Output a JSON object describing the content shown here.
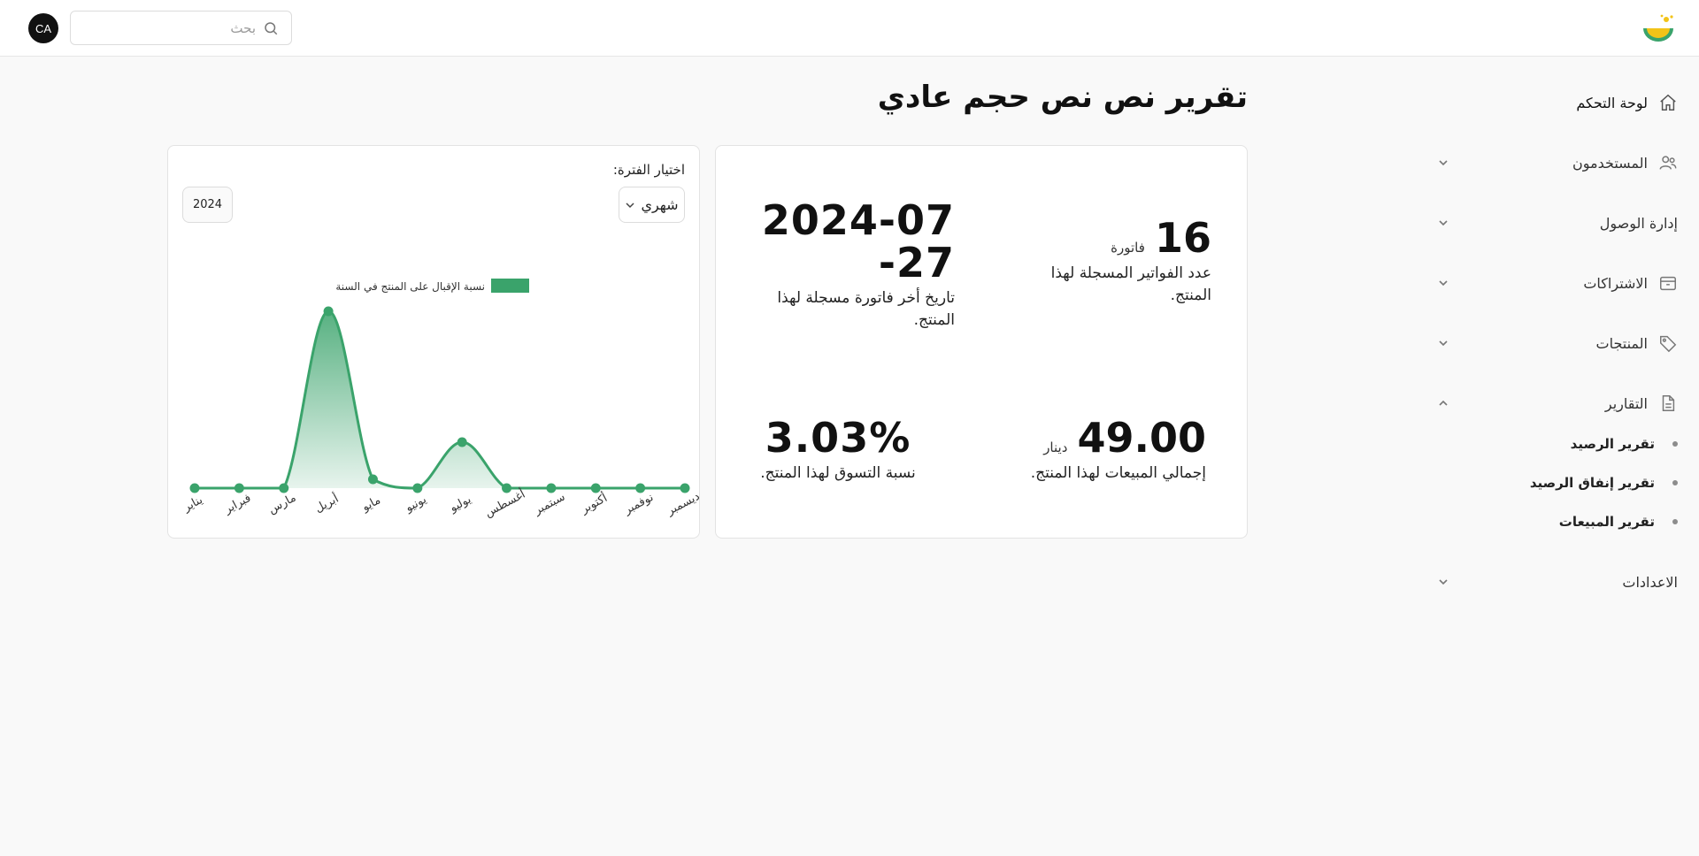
{
  "header": {
    "avatar_initials": "CA",
    "search_placeholder": "بحث",
    "search_icon": "search-icon",
    "logo": "brand-logo"
  },
  "sidebar": {
    "items": [
      {
        "label": "لوحة التحكم",
        "icon": "home-icon",
        "has_chevron": false
      },
      {
        "label": "المستخدمون",
        "icon": "users-icon",
        "has_chevron": true
      },
      {
        "label": "إدارة الوصول",
        "icon": "",
        "has_chevron": true
      },
      {
        "label": "الاشتراكات",
        "icon": "box-icon",
        "has_chevron": true
      },
      {
        "label": "المنتجات",
        "icon": "tag-icon",
        "has_chevron": true
      },
      {
        "label": "التقارير",
        "icon": "file-icon",
        "has_chevron": true,
        "expanded": true
      },
      {
        "label": "الاعدادات",
        "icon": "",
        "has_chevron": true
      }
    ],
    "reports_sub": [
      {
        "label": "تقرير الرصيد"
      },
      {
        "label": "تقرير إنفاق الرصيد"
      },
      {
        "label": "تقرير المبيعات"
      }
    ]
  },
  "main": {
    "title": "تقرير نص نص حجم عادي"
  },
  "stats": {
    "invoice_count": {
      "value": "16",
      "unit": "فاتورة",
      "desc": "عدد الفواتير المسجلة لهذا المنتج."
    },
    "last_invoice": {
      "value": "2024-07-27",
      "desc": "تاريخ أخر فاتورة مسجلة لهذا المنتج."
    },
    "total_sales": {
      "value": "49.00",
      "unit": "دينار",
      "desc": "إجمالي المبيعات لهذا المنتج."
    },
    "market_share": {
      "value": "3.03%",
      "desc": "نسبة التسوق لهذا المنتج."
    }
  },
  "chart_panel": {
    "period_label": "اختيار الفترة:",
    "period_value": "شهري",
    "year": "2024"
  },
  "chart_data": {
    "type": "area",
    "categories": [
      "يناير",
      "فبراير",
      "مارس",
      "أبريل",
      "مايو",
      "يونيو",
      "يوليو",
      "أغسطس",
      "سبتمبر",
      "أكتوبر",
      "نوفمبر",
      "ديسمبر"
    ],
    "series": [
      {
        "name": "نسبة الإقبال على المنتج في السنة",
        "values": [
          0,
          0,
          0,
          10,
          0.5,
          0,
          2.6,
          0,
          0,
          0,
          0,
          0
        ]
      }
    ],
    "ylim": [
      0,
      10.5
    ],
    "grid": false,
    "legend": "top",
    "color": "#3aa36b"
  }
}
